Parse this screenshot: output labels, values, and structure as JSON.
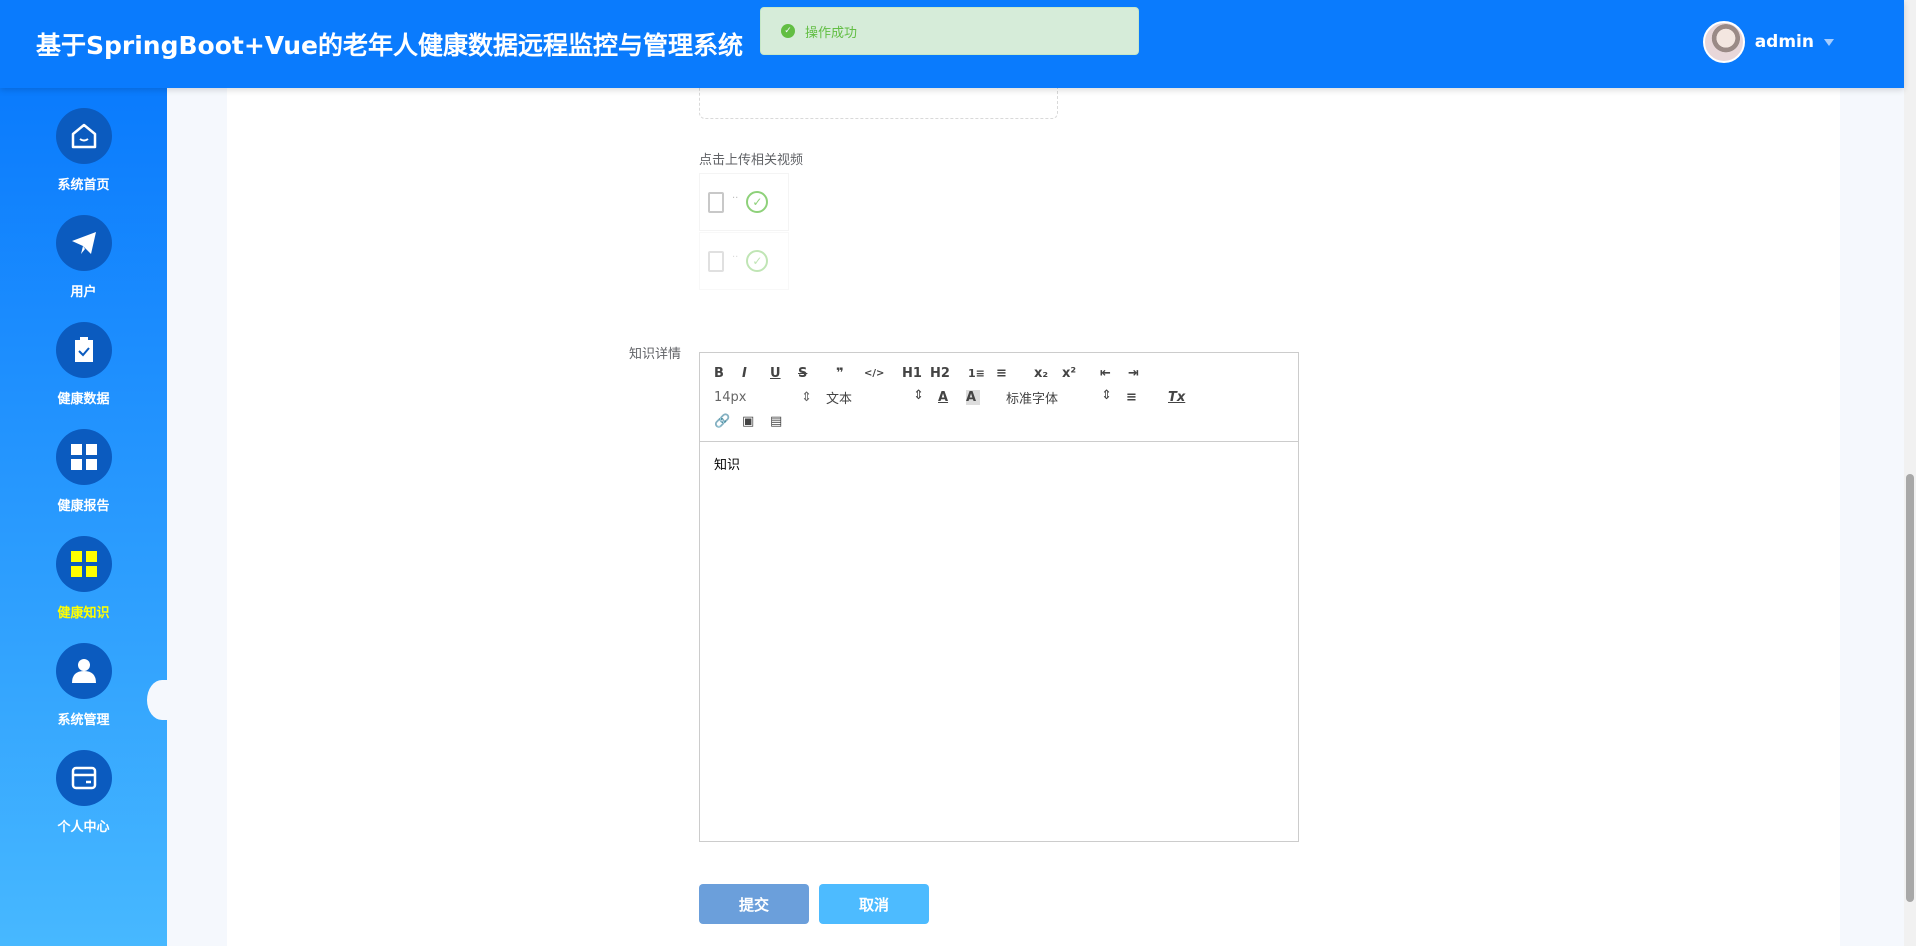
{
  "header": {
    "title": "基于SpringBoot+Vue的老年人健康数据远程监控与管理系统",
    "username": "admin"
  },
  "toast": {
    "message": "操作成功",
    "color": "#67c23a"
  },
  "sidebar": {
    "items": [
      {
        "label": "系统首页",
        "icon": "home-icon"
      },
      {
        "label": "用户",
        "icon": "paper-plane-icon"
      },
      {
        "label": "健康数据",
        "icon": "clipboard-check-icon"
      },
      {
        "label": "健康报告",
        "icon": "grid-icon"
      },
      {
        "label": "健康知识",
        "icon": "grid-icon",
        "active": true
      },
      {
        "label": "系统管理",
        "icon": "user-icon"
      },
      {
        "label": "个人中心",
        "icon": "wallet-icon"
      }
    ]
  },
  "form": {
    "video_upload_label": "点击上传相关视频",
    "files": [
      {
        "name": "..",
        "status": "success"
      },
      {
        "name": "..",
        "status": "success"
      }
    ],
    "detail_label": "知识详情",
    "editor": {
      "toolbar_row1": [
        "B",
        "I",
        "U",
        "S",
        "❞",
        "</>",
        "H1",
        "H2",
        "1≡",
        "≡",
        "x₂",
        "x²",
        "⇤",
        "⇥"
      ],
      "font_size": "14px",
      "header_select": "文本",
      "text_color": "A",
      "bg_color": "A",
      "font_family": "标准字体",
      "align": "≡",
      "clean": "Tx",
      "toolbar_row3": [
        "🔗",
        "▣",
        "▤"
      ],
      "content": "知识"
    },
    "submit_label": "提交",
    "cancel_label": "取消"
  },
  "colors": {
    "header": "#0a7bfd",
    "submit": "#6b9fdb",
    "cancel": "#4dbbff",
    "active_nav": "#ffff00"
  }
}
